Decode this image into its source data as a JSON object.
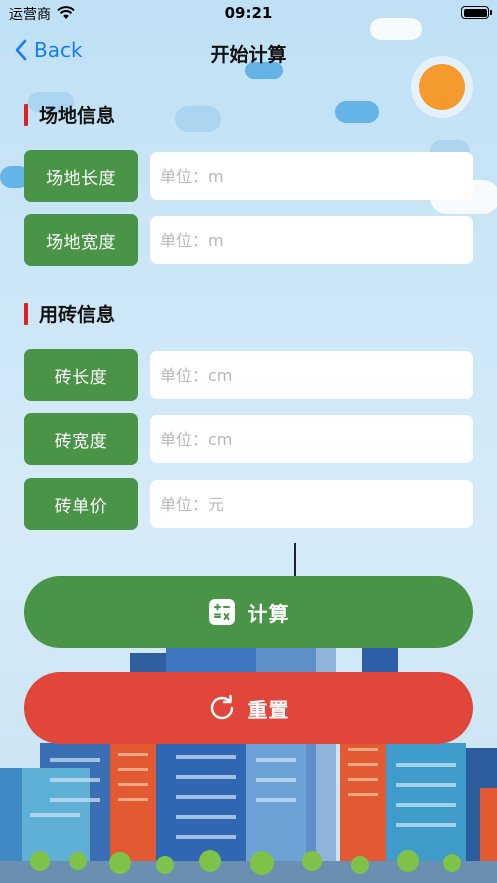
{
  "status_bar": {
    "carrier": "运营商",
    "time": "09:21"
  },
  "nav": {
    "back_label": "Back",
    "title": "开始计算"
  },
  "site_section": {
    "title": "场地信息",
    "fields": [
      {
        "label": "场地长度",
        "placeholder": "单位：m",
        "value": ""
      },
      {
        "label": "场地宽度",
        "placeholder": "单位：m",
        "value": ""
      }
    ]
  },
  "brick_section": {
    "title": "用砖信息",
    "fields": [
      {
        "label": "砖长度",
        "placeholder": "单位：cm",
        "value": ""
      },
      {
        "label": "砖宽度",
        "placeholder": "单位：cm",
        "value": ""
      },
      {
        "label": "砖单价",
        "placeholder": "单位：元",
        "value": ""
      }
    ]
  },
  "actions": {
    "calculate_label": "计算",
    "calculate_icon": "calculator-icon",
    "reset_label": "重置",
    "reset_icon": "refresh-icon"
  },
  "colors": {
    "label_green": "#4a9447",
    "calc_green": "#4a9447",
    "reset_red": "#e1463b",
    "section_bar_red": "#e02020",
    "link_blue": "#1a7cf5"
  },
  "icons": {
    "wifi": "wifi-icon",
    "battery": "battery-icon",
    "back": "chevron-left-icon"
  }
}
